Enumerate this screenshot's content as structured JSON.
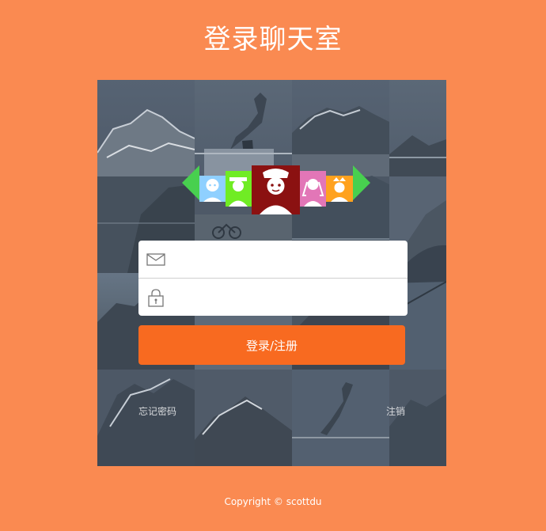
{
  "page": {
    "title": "登录聊天室"
  },
  "login": {
    "email_placeholder": "",
    "password_placeholder": "",
    "submit_label": "登录/注册",
    "forgot_label": "忘记密码",
    "cancel_label": "注销"
  },
  "footer": {
    "copyright": "Copyright © scottdu"
  },
  "avatars": [
    {
      "name": "boy-avatar",
      "bg": "#8fd0ff"
    },
    {
      "name": "farmer-avatar",
      "bg": "#70ec24"
    },
    {
      "name": "nurse-avatar",
      "bg": "#8b1111"
    },
    {
      "name": "girl-braids-avatar",
      "bg": "#e276b7"
    },
    {
      "name": "princess-avatar",
      "bg": "#ffa21f"
    }
  ],
  "colors": {
    "background": "#fa8a51",
    "button": "#f86a20",
    "panel_overlay": "#4a5665",
    "arrow": "#48d04f"
  }
}
